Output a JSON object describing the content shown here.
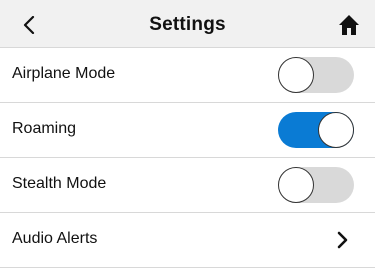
{
  "header": {
    "title": "Settings",
    "back_icon": "chevron-left-icon",
    "home_icon": "home-icon"
  },
  "rows": [
    {
      "label": "Airplane Mode",
      "control": "toggle",
      "state": "off"
    },
    {
      "label": "Roaming",
      "control": "toggle",
      "state": "on"
    },
    {
      "label": "Stealth Mode",
      "control": "toggle",
      "state": "off"
    },
    {
      "label": "Audio Alerts",
      "control": "chevron",
      "icon": "chevron-right-icon"
    }
  ],
  "colors": {
    "header_bg": "#f1f1f1",
    "toggle_on": "#0a7bd4",
    "toggle_off": "#d9d9d9",
    "divider": "#d8d8d8"
  }
}
